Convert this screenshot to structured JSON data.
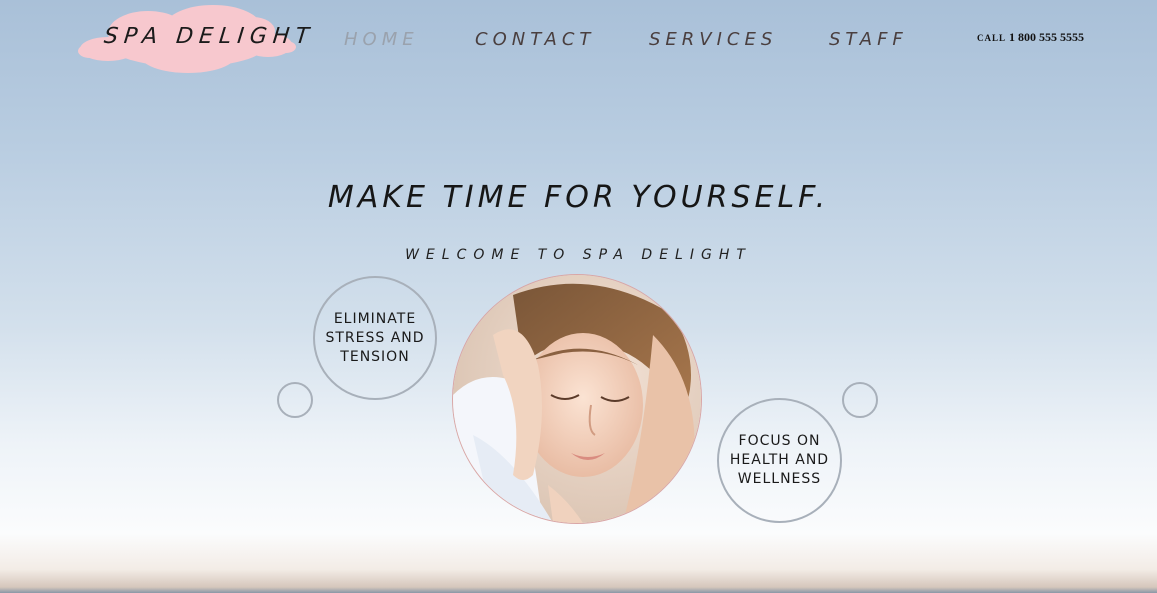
{
  "brand": {
    "name": "SPA DELIGHT",
    "cloud_color": "#f6c6cc"
  },
  "nav": {
    "items": [
      {
        "label": "HOME",
        "active": true
      },
      {
        "label": "CONTACT",
        "active": false
      },
      {
        "label": "SERVICES",
        "active": false
      },
      {
        "label": "STAFF",
        "active": false
      }
    ]
  },
  "phone": {
    "prefix": "CALL",
    "number": "1 800 555 5555"
  },
  "hero": {
    "title": "MAKE TIME FOR YOURSELF.",
    "subtitle": "WELCOME TO SPA DELIGHT",
    "features": [
      "ELIMINATE STRESS AND TENSION",
      "FOCUS ON HEALTH AND WELLNESS"
    ]
  }
}
